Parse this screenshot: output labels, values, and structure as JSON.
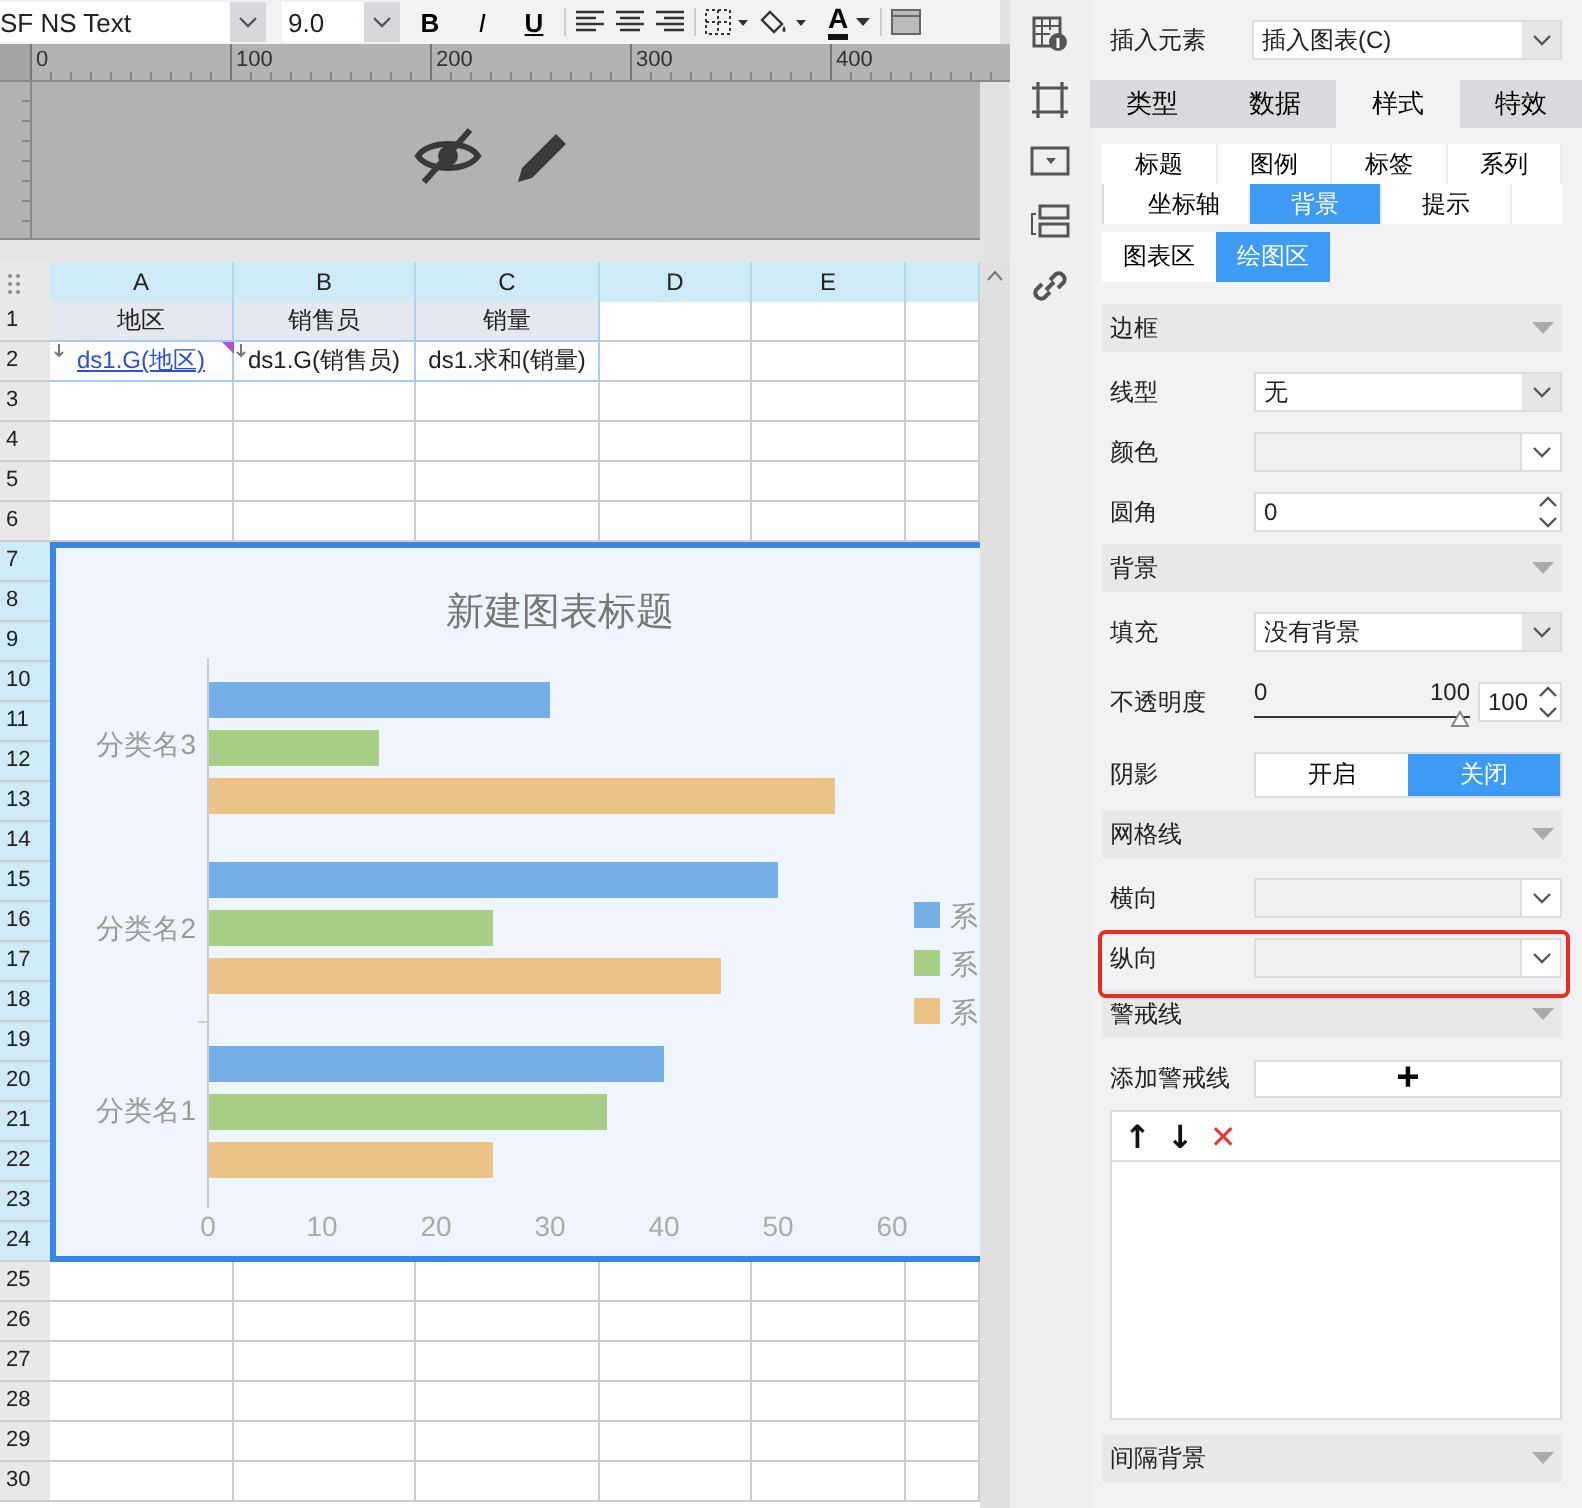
{
  "toolbar": {
    "font": "SF NS Text",
    "size": "9.0",
    "format_buttons": [
      "B",
      "I",
      "U"
    ],
    "font_color_glyph": "A"
  },
  "ruler": {
    "marks": [
      "0",
      "100",
      "200",
      "300",
      "400"
    ]
  },
  "sheet": {
    "columns": [
      "A",
      "B",
      "C",
      "D",
      "E"
    ],
    "row_numbers": [
      "1",
      "2",
      "3",
      "4",
      "5",
      "6",
      "7",
      "8",
      "9",
      "10",
      "11",
      "12",
      "13",
      "14",
      "15",
      "16",
      "17",
      "18",
      "19",
      "20",
      "21",
      "22",
      "23",
      "24",
      "25",
      "26",
      "27",
      "28",
      "29",
      "30"
    ],
    "rows": [
      [
        {
          "text": "地区",
          "kind": "header"
        },
        {
          "text": "销售员",
          "kind": "header"
        },
        {
          "text": "销量",
          "kind": "header"
        }
      ],
      [
        {
          "text": "ds1.G(地区)",
          "kind": "link"
        },
        {
          "text": "ds1.G(销售员)",
          "kind": "field"
        },
        {
          "text": "ds1.求和(销量)",
          "kind": "field"
        }
      ]
    ]
  },
  "chart": {
    "chart_data": {
      "type": "bar",
      "orientation": "horizontal",
      "title": "新建图表标题",
      "categories": [
        "分类名3",
        "分类名2",
        "分类名1"
      ],
      "series": [
        {
          "name": "系",
          "color": "#74afe8",
          "values": [
            30,
            50,
            40
          ]
        },
        {
          "name": "系",
          "color": "#a6ce84",
          "values": [
            15,
            25,
            35
          ]
        },
        {
          "name": "系",
          "color": "#ecc386",
          "values": [
            55,
            45,
            25
          ]
        }
      ],
      "xlim": [
        0,
        60
      ],
      "xticks": [
        0,
        10,
        20,
        30,
        40,
        50,
        60
      ]
    }
  },
  "panel": {
    "insert_label": "插入元素",
    "insert_value": "插入图表(C)",
    "tabs": [
      {
        "label": "类型",
        "selected": false
      },
      {
        "label": "数据",
        "selected": false
      },
      {
        "label": "样式",
        "selected": true
      },
      {
        "label": "特效",
        "selected": false
      }
    ],
    "subtabs": [
      [
        {
          "label": "标题",
          "selected": false
        },
        {
          "label": "图例",
          "selected": false
        },
        {
          "label": "标签",
          "selected": false
        },
        {
          "label": "系列",
          "selected": false
        }
      ],
      [
        {
          "label": "坐标轴",
          "selected": false
        },
        {
          "label": "背景",
          "selected": true
        },
        {
          "label": "提示",
          "selected": false
        }
      ]
    ],
    "area_tabs": [
      {
        "label": "图表区",
        "selected": false
      },
      {
        "label": "绘图区",
        "selected": true
      }
    ],
    "items": [
      {
        "kind": "header",
        "label": "边框"
      },
      {
        "kind": "select",
        "label": "线型",
        "value": "无",
        "disabled": false,
        "highlighted": false
      },
      {
        "kind": "select",
        "label": "颜色",
        "disabled": true,
        "highlighted": false
      },
      {
        "kind": "number",
        "label": "圆角",
        "value": "0",
        "highlighted": false
      },
      {
        "kind": "header",
        "label": "背景"
      },
      {
        "kind": "select",
        "label": "填充",
        "value": "没有背景",
        "disabled": false,
        "highlighted": false
      },
      {
        "kind": "slider",
        "label": "不透明度",
        "min_label": "0",
        "max_label": "100",
        "level": 1,
        "value": "100",
        "highlighted": false
      },
      {
        "kind": "toggle",
        "label": "阴影",
        "options": [
          {
            "label": "开启",
            "selected": false
          },
          {
            "label": "关闭",
            "selected": true
          }
        ],
        "highlighted": false
      },
      {
        "kind": "header",
        "label": "网格线"
      },
      {
        "kind": "select",
        "label": "横向",
        "disabled": true,
        "highlighted": false
      },
      {
        "kind": "select",
        "label": "纵向",
        "disabled": true,
        "highlighted": true
      },
      {
        "kind": "header",
        "label": "警戒线"
      },
      {
        "kind": "button",
        "label": "添加警戒线",
        "text": "+",
        "highlighted": false
      },
      {
        "kind": "list",
        "tools": [
          {
            "text": "↑",
            "color": "#111111"
          },
          {
            "text": "↓",
            "color": "#111111"
          },
          {
            "text": "✕",
            "color": "#e53935"
          }
        ]
      },
      {
        "kind": "header",
        "label": "间隔背景"
      }
    ]
  }
}
